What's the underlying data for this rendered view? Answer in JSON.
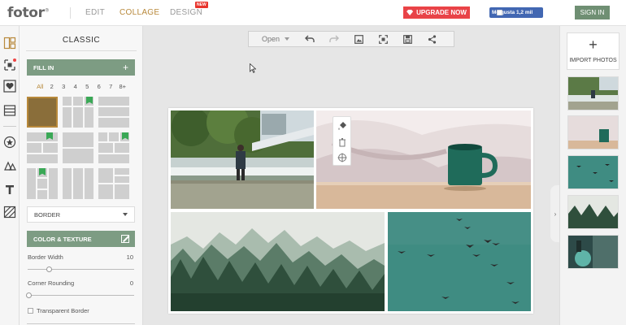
{
  "header": {
    "logo": "fotor",
    "logo_mark": "®",
    "nav": [
      {
        "label": "EDIT"
      },
      {
        "label": "COLLAGE"
      },
      {
        "label": "DESIGN"
      }
    ],
    "new_badge": "NEW",
    "upgrade_label": "UPGRADE NOW",
    "like_label": "Me gusta 1,2 mil",
    "signin_label": "SIGN IN"
  },
  "rail": {
    "icons": [
      "template-icon",
      "stitch-icon",
      "heart-icon",
      "layout-icon",
      "star-icon",
      "shapes-icon",
      "text-icon",
      "pattern-icon"
    ]
  },
  "panel": {
    "title": "CLASSIC",
    "fill_in_label": "FILL IN",
    "fill_in_action": "+",
    "filters": [
      "All",
      "2",
      "3",
      "4",
      "5",
      "6",
      "7",
      "8+"
    ],
    "border_select": "BORDER",
    "color_texture_label": "COLOR & TEXTURE",
    "border_width_label": "Border Width",
    "border_width_value": "10",
    "corner_rounding_label": "Corner Rounding",
    "corner_rounding_value": "0",
    "transparent_border_label": "Transparent Border"
  },
  "toolbar": {
    "open_label": "Open",
    "buttons": [
      "undo-icon",
      "redo-icon",
      "image-resize-icon",
      "fit-icon",
      "save-icon",
      "share-icon"
    ]
  },
  "right_panel": {
    "import_plus": "+",
    "import_label": "IMPORT PHOTOS",
    "collapse_glyph": "›"
  },
  "colors": {
    "accent_gold": "#b8893b",
    "section_green": "#7d9c83",
    "upgrade_red": "#e84348",
    "facebook_blue": "#4267b2",
    "signin_green": "#6f8f73"
  }
}
